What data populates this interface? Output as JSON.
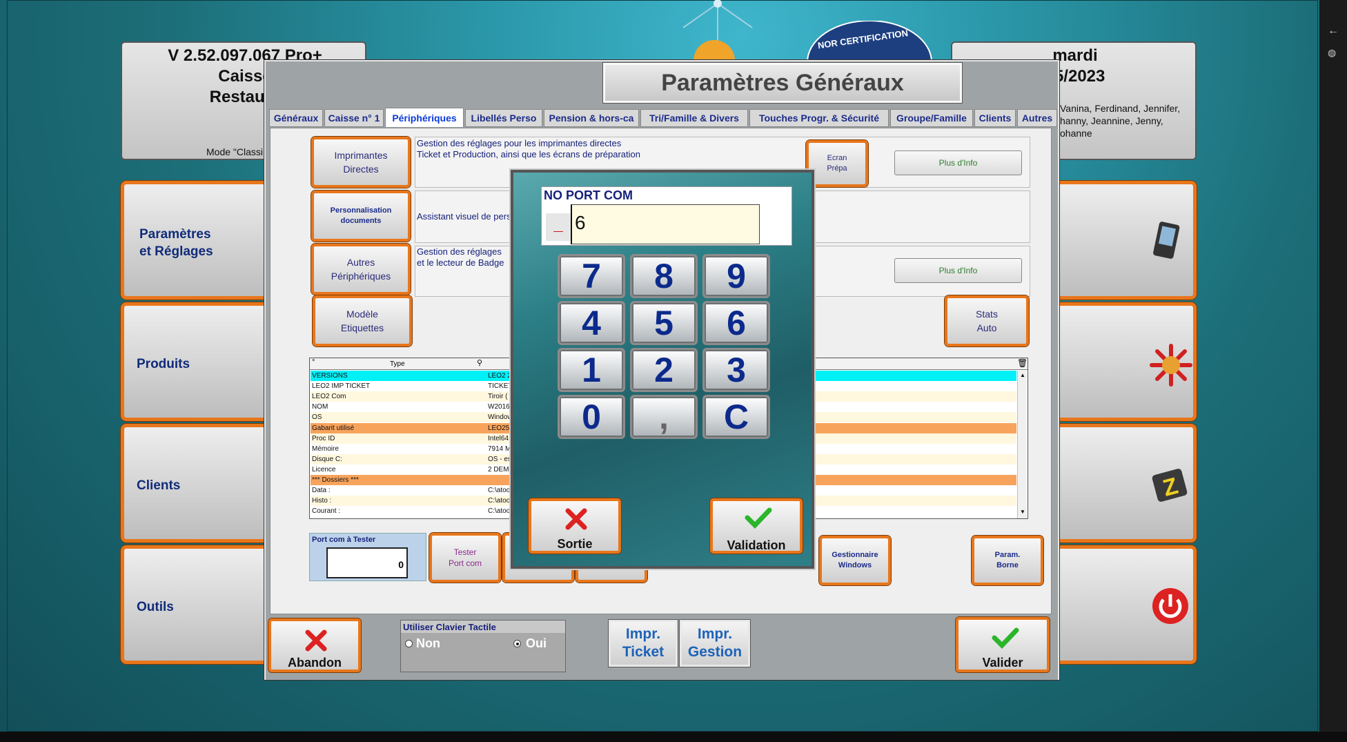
{
  "app": {
    "version": "V 2.52.097.067  Pro+",
    "line2": "Caisse",
    "line3": "Restaura",
    "mode": "Mode \"Classi",
    "day": "mardi",
    "date": "05/2023",
    "names_line1": "Vanina, Ferdinand, Jennifer,",
    "names_line2": "hanny, Jeannine, Jenny,",
    "names_line3": "ohanne",
    "certification": "NOR CERTIFICATION"
  },
  "side_menu": [
    {
      "label1": "Paramètres",
      "label2": "et Réglages",
      "icon": "pda-device-icon"
    },
    {
      "label1": "Produits",
      "icon": "euro-sun-icon"
    },
    {
      "label1": "Clients",
      "icon": "z-notebook-icon"
    },
    {
      "label1": "Outils",
      "icon": "power-icon"
    }
  ],
  "dialog": {
    "title": "Paramètres Généraux",
    "tabs": [
      "Généraux",
      "Caisse n° 1",
      "Périphériques",
      "Libellés Perso",
      "Pension & hors-ca",
      "Tri/Famille & Divers",
      "Touches Progr. & Sécurité",
      "Groupe/Famille",
      "Clients",
      "Autres"
    ],
    "active_tab": "Périphériques",
    "sections": {
      "imprimantes": {
        "button": "Imprimantes\nDirectes",
        "text": "Gestion des réglages pour les imprimantes directes\nTicket et Production, ainsi que les écrans de préparation",
        "ecran": "Ecran\nPrépa",
        "info": "Plus d'Info"
      },
      "personnalisation": {
        "button": "Personnalisation\ndocuments",
        "text": "Assistant visuel de pers"
      },
      "autres": {
        "button": "Autres\nPériphériques",
        "text": "Gestion des réglages\net le lecteur de Badge",
        "info": "Plus d'Info"
      },
      "modele": {
        "button": "Modèle\nEtiquettes"
      },
      "stats": {
        "button": "Stats\nAuto"
      }
    },
    "grid": {
      "header": {
        "sort": "°",
        "col1": "Type"
      },
      "rows": [
        {
          "c1": "VERSIONS",
          "c2": "LEO2 2",
          "style": "cyan"
        },
        {
          "c1": "LEO2 IMP TICKET",
          "c2": "TICKET",
          "style": "white"
        },
        {
          "c1": "LEO2 Com",
          "c2": " Tiroir (",
          "style": "cream"
        },
        {
          "c1": "NOM",
          "c2": "W2016-",
          "style": "white"
        },
        {
          "c1": "OS",
          "c2": "Window",
          "style": "cream"
        },
        {
          "c1": "Gabarit utilisé",
          "c2": "LEO250",
          "style": "orange"
        },
        {
          "c1": "Proc ID",
          "c2": "Intel64 I",
          "style": "cream"
        },
        {
          "c1": "Mémoire",
          "c2": "7914 Mo",
          "style": "white"
        },
        {
          "c1": "Disque C:",
          "c2": "OS - esp",
          "style": "cream"
        },
        {
          "c1": "Licence",
          "c2": "2 DEMO",
          "style": "white"
        },
        {
          "c1": "*** Dossiers ***",
          "c2": "",
          "style": "orange"
        },
        {
          "c1": "Data :",
          "c2": "C:\\atoo",
          "style": "white"
        },
        {
          "c1": "Histo :",
          "c2": "C:\\atoo",
          "style": "cream"
        },
        {
          "c1": "Courant :",
          "c2": "C:\\atoo",
          "style": "white"
        }
      ]
    },
    "port": {
      "label": "Port com à Tester",
      "value": "0",
      "test_button": "Tester\nPort com"
    },
    "gestionnaire": "Gestionnaire\nWindows",
    "param_borne": "Param.\nBorne",
    "keyboard": {
      "label": "Utiliser Clavier Tactile",
      "non": "Non",
      "oui": "Oui",
      "selected": "Oui"
    },
    "impr_ticket": [
      "Impr.",
      "Ticket"
    ],
    "impr_gestion": [
      "Impr.",
      "Gestion"
    ],
    "abandon": "Abandon",
    "valider": "Valider"
  },
  "numpad": {
    "label": "NO PORT COM",
    "sign": "_",
    "value": "6",
    "keys": [
      "7",
      "8",
      "9",
      "4",
      "5",
      "6",
      "1",
      "2",
      "3",
      "0",
      ",",
      "C"
    ],
    "sortie": "Sortie",
    "validation": "Validation"
  },
  "colors": {
    "accent_orange": "#e8761b",
    "title_blue": "#102b79",
    "grid_cyan": "#00f0f8",
    "grid_orange": "#f7a35c",
    "grid_cream": "#fff8df"
  }
}
